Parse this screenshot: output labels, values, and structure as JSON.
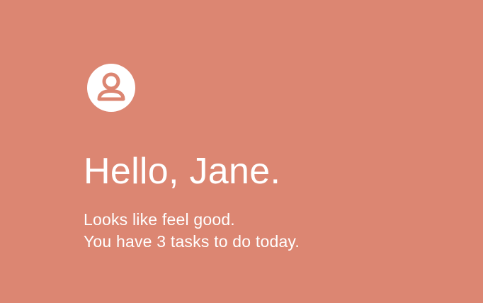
{
  "theme": {
    "background": "#DC8672",
    "foreground": "#FFFFFF"
  },
  "profile": {
    "icon": "user-circle-icon"
  },
  "greeting": "Hello, Jane.",
  "message": {
    "line1": "Looks like feel good.",
    "line2": "You have 3 tasks to do today."
  }
}
